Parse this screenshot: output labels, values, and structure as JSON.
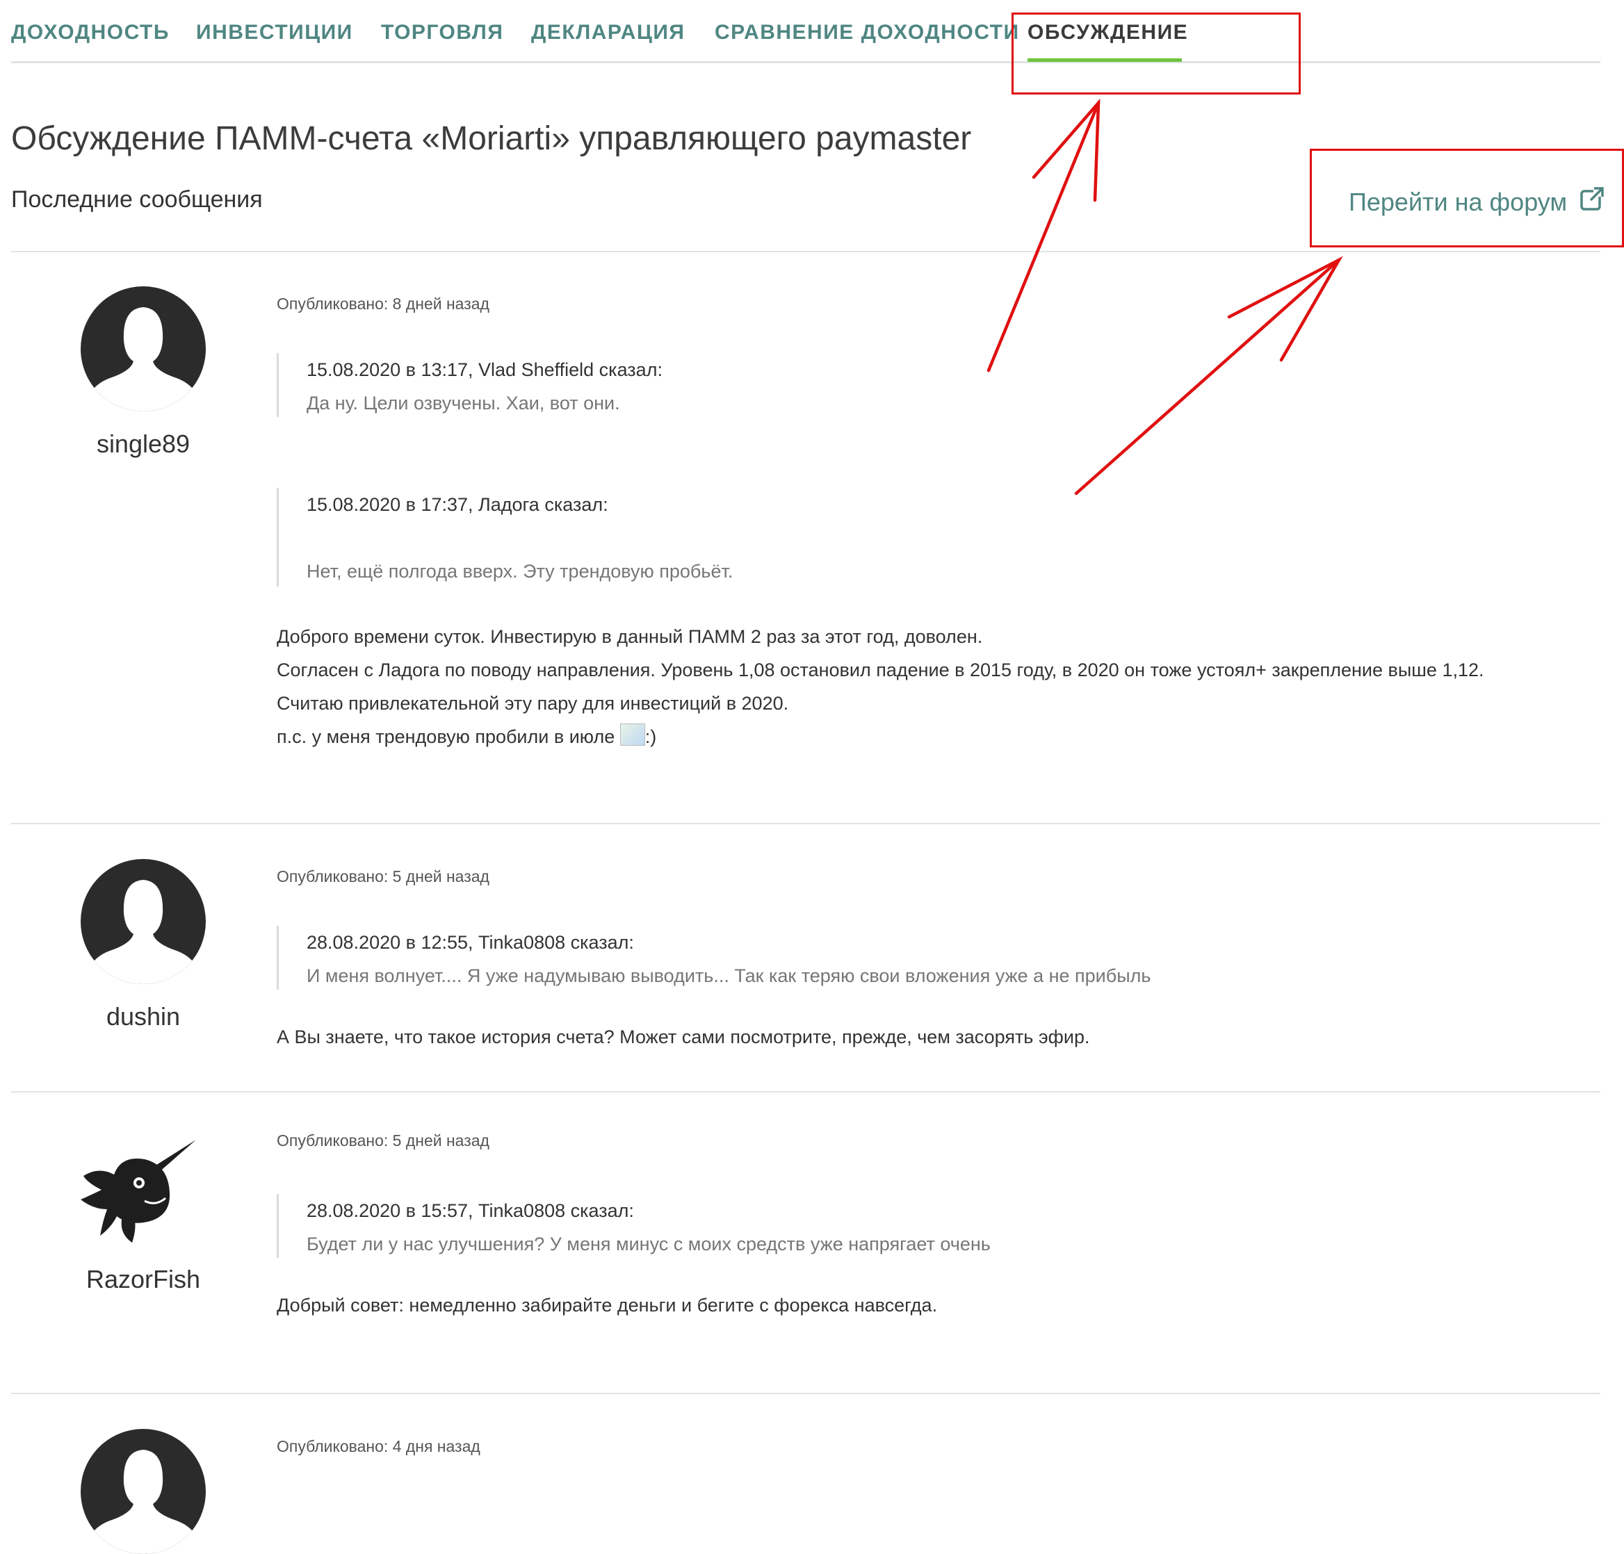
{
  "tabs": [
    {
      "label": "ДОХОДНОСТЬ"
    },
    {
      "label": "ИНВЕСТИЦИИ"
    },
    {
      "label": "ТОРГОВЛЯ"
    },
    {
      "label": "ДЕКЛАРАЦИЯ"
    },
    {
      "label": "СРАВНЕНИЕ ДОХОДНОСТИ"
    },
    {
      "label": "ОБСУЖДЕНИЕ",
      "active": true
    }
  ],
  "page": {
    "title": "Обсуждение ПАММ-счета «Moriarti» управляющего paymaster",
    "subtitle": "Последние сообщения",
    "forum_link": "Перейти на форум"
  },
  "colors": {
    "tab_text": "#4f8682",
    "active_underline": "#6fc33c",
    "annotation": "#e01010"
  },
  "posts": [
    {
      "username": "single89",
      "posted": "Опубликовано: 8 дней назад",
      "quotes": [
        {
          "head": "15.08.2020 в 13:17, Vlad Sheffield сказал:",
          "text": "Да ну. Цели озвучены. Хаи, вот они."
        },
        {
          "head": "15.08.2020 в 17:37, Ладога сказал:",
          "text": "Нет, ещё полгода вверх. Эту трендовую пробьёт."
        }
      ],
      "body": [
        "Доброго времени суток. Инвестирую в данный ПАММ 2 раз за этот год, доволен.",
        "Согласен с Ладога по поводу направления. Уровень 1,08 остановил падение в  2015 году, в 2020 он тоже устоял+ закрепление выше 1,12.",
        "Считаю привлекательной эту пару для инвестиций в 2020.",
        "п.с. у меня трендовую пробили в июле",
        ":)"
      ]
    },
    {
      "username": "dushin",
      "posted": "Опубликовано: 5 дней назад",
      "quotes": [
        {
          "head": "28.08.2020 в 12:55, Tinka0808 сказал:",
          "text": "И меня волнует.... Я уже надумываю выводить... Так как теряю свои вложения уже а не прибыль"
        }
      ],
      "body": [
        "А Вы знаете, что такое история счета? Может сами посмотрите, прежде, чем засорять эфир."
      ]
    },
    {
      "username": "RazorFish",
      "posted": "Опубликовано: 5 дней назад",
      "quotes": [
        {
          "head": "28.08.2020 в 15:57, Tinka0808 сказал:",
          "text": "Будет ли у нас улучшения? У меня минус с моих средств уже напрягает очень"
        }
      ],
      "body": [
        "Добрый совет: немедленно забирайте деньги и бегите с форекса навсегда."
      ]
    },
    {
      "posted": "Опубликовано: 4 дня назад"
    }
  ]
}
